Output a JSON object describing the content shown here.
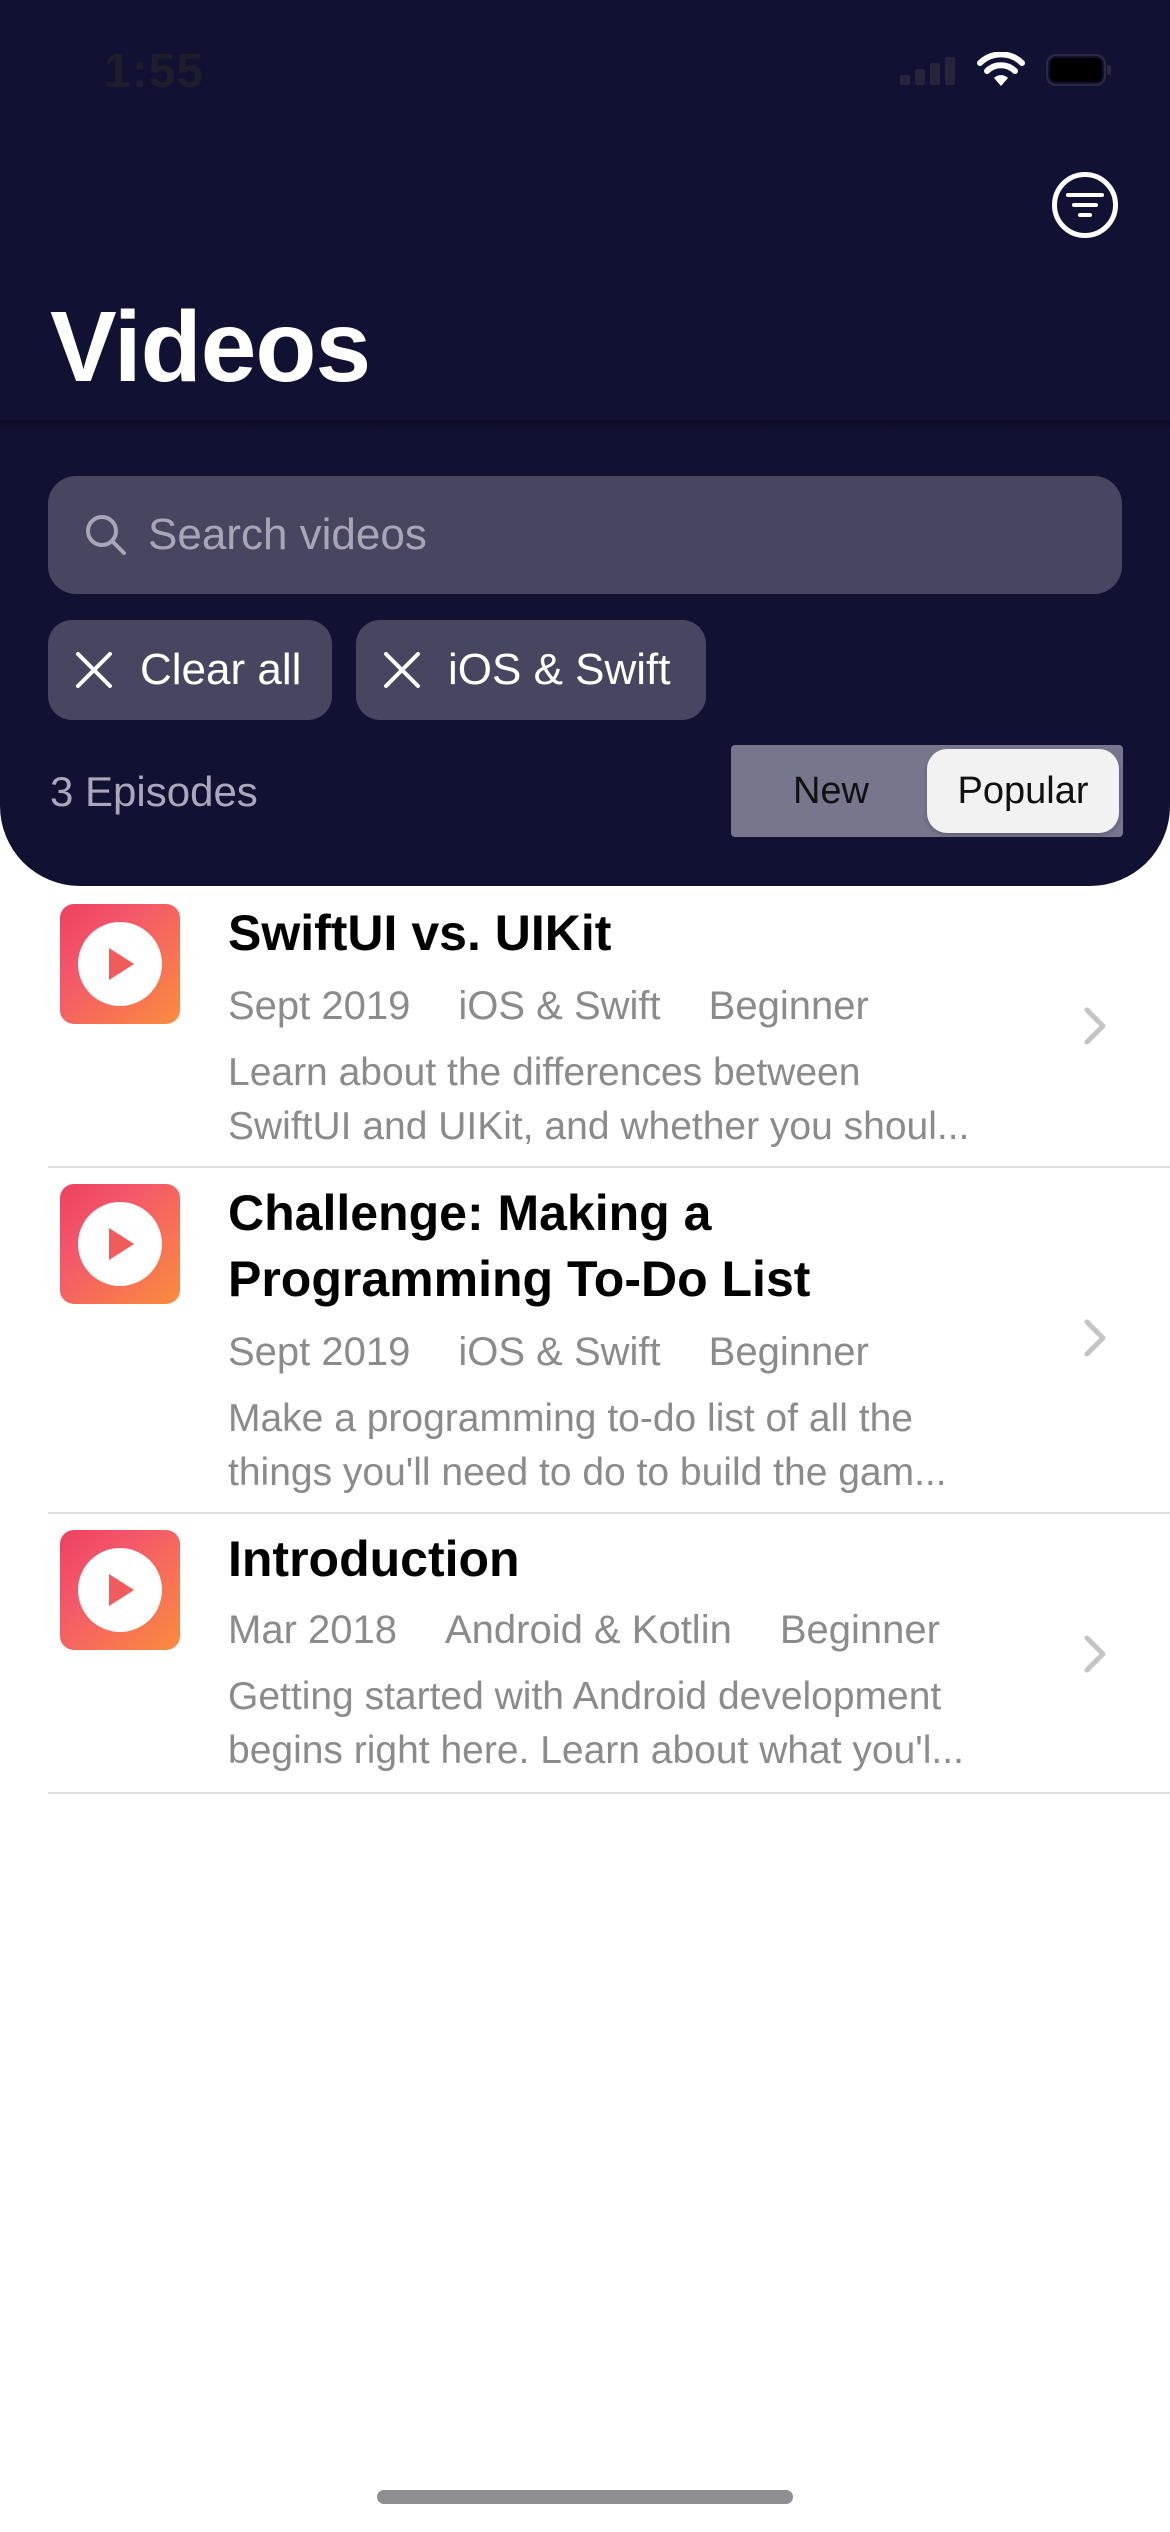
{
  "status_bar": {
    "time": "1:55"
  },
  "header": {
    "title": "Videos",
    "filter_icon": "filter-list-icon"
  },
  "search": {
    "placeholder": "Search videos",
    "value": ""
  },
  "chips": [
    {
      "label": "Clear all",
      "icon": "close-icon"
    },
    {
      "label": "iOS & Swift",
      "icon": "close-icon"
    }
  ],
  "episodes_count": "3 Episodes",
  "sort": {
    "options": [
      "New",
      "Popular"
    ],
    "selected": "Popular"
  },
  "episodes": [
    {
      "title_lines": [
        "SwiftUI vs. UIKit"
      ],
      "date": "Sept 2019",
      "platform": "iOS & Swift",
      "level": "Beginner",
      "description_lines": [
        "Learn about the differences between",
        "SwiftUI and UIKit, and whether you shoul..."
      ]
    },
    {
      "title_lines": [
        "Challenge: Making a",
        "Programming To-Do List"
      ],
      "date": "Sept 2019",
      "platform": "iOS & Swift",
      "level": "Beginner",
      "description_lines": [
        "Make a programming to-do list of all the",
        "things you'll need to do to build the gam..."
      ]
    },
    {
      "title_lines": [
        "Introduction"
      ],
      "date": "Mar 2018",
      "platform": "Android & Kotlin",
      "level": "Beginner",
      "description_lines": [
        "Getting started with Android development",
        "begins right here. Learn about what you'l..."
      ]
    }
  ],
  "colors": {
    "header_bg": "#111133",
    "chip_bg": "#474660",
    "thumb_gradient_start": "#ee4061",
    "thumb_gradient_end": "#fb8c3d"
  }
}
